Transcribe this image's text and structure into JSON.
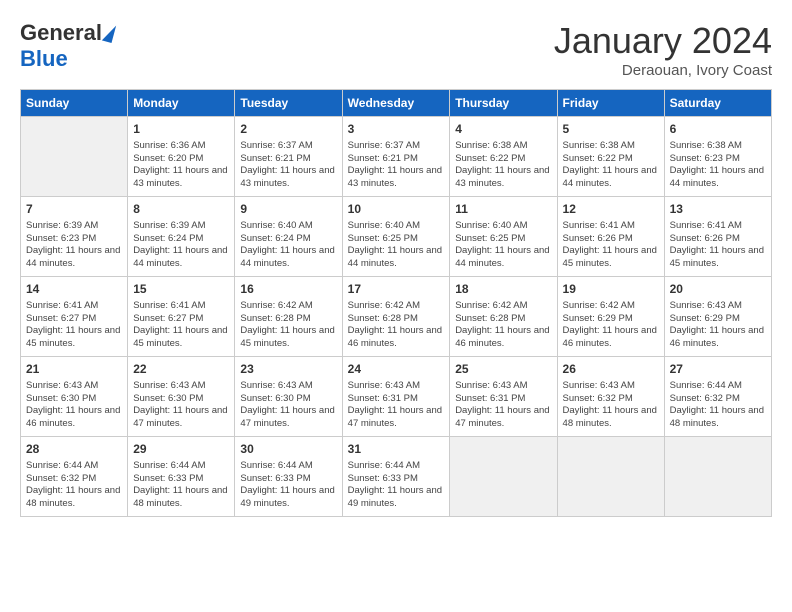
{
  "header": {
    "logo_general": "General",
    "logo_blue": "Blue",
    "month_title": "January 2024",
    "subtitle": "Deraouan, Ivory Coast"
  },
  "days_of_week": [
    "Sunday",
    "Monday",
    "Tuesday",
    "Wednesday",
    "Thursday",
    "Friday",
    "Saturday"
  ],
  "weeks": [
    [
      {
        "day": "",
        "sunrise": "",
        "sunset": "",
        "daylight": ""
      },
      {
        "day": "1",
        "sunrise": "Sunrise: 6:36 AM",
        "sunset": "Sunset: 6:20 PM",
        "daylight": "Daylight: 11 hours and 43 minutes."
      },
      {
        "day": "2",
        "sunrise": "Sunrise: 6:37 AM",
        "sunset": "Sunset: 6:21 PM",
        "daylight": "Daylight: 11 hours and 43 minutes."
      },
      {
        "day": "3",
        "sunrise": "Sunrise: 6:37 AM",
        "sunset": "Sunset: 6:21 PM",
        "daylight": "Daylight: 11 hours and 43 minutes."
      },
      {
        "day": "4",
        "sunrise": "Sunrise: 6:38 AM",
        "sunset": "Sunset: 6:22 PM",
        "daylight": "Daylight: 11 hours and 43 minutes."
      },
      {
        "day": "5",
        "sunrise": "Sunrise: 6:38 AM",
        "sunset": "Sunset: 6:22 PM",
        "daylight": "Daylight: 11 hours and 44 minutes."
      },
      {
        "day": "6",
        "sunrise": "Sunrise: 6:38 AM",
        "sunset": "Sunset: 6:23 PM",
        "daylight": "Daylight: 11 hours and 44 minutes."
      }
    ],
    [
      {
        "day": "7",
        "sunrise": "Sunrise: 6:39 AM",
        "sunset": "Sunset: 6:23 PM",
        "daylight": "Daylight: 11 hours and 44 minutes."
      },
      {
        "day": "8",
        "sunrise": "Sunrise: 6:39 AM",
        "sunset": "Sunset: 6:24 PM",
        "daylight": "Daylight: 11 hours and 44 minutes."
      },
      {
        "day": "9",
        "sunrise": "Sunrise: 6:40 AM",
        "sunset": "Sunset: 6:24 PM",
        "daylight": "Daylight: 11 hours and 44 minutes."
      },
      {
        "day": "10",
        "sunrise": "Sunrise: 6:40 AM",
        "sunset": "Sunset: 6:25 PM",
        "daylight": "Daylight: 11 hours and 44 minutes."
      },
      {
        "day": "11",
        "sunrise": "Sunrise: 6:40 AM",
        "sunset": "Sunset: 6:25 PM",
        "daylight": "Daylight: 11 hours and 44 minutes."
      },
      {
        "day": "12",
        "sunrise": "Sunrise: 6:41 AM",
        "sunset": "Sunset: 6:26 PM",
        "daylight": "Daylight: 11 hours and 45 minutes."
      },
      {
        "day": "13",
        "sunrise": "Sunrise: 6:41 AM",
        "sunset": "Sunset: 6:26 PM",
        "daylight": "Daylight: 11 hours and 45 minutes."
      }
    ],
    [
      {
        "day": "14",
        "sunrise": "Sunrise: 6:41 AM",
        "sunset": "Sunset: 6:27 PM",
        "daylight": "Daylight: 11 hours and 45 minutes."
      },
      {
        "day": "15",
        "sunrise": "Sunrise: 6:41 AM",
        "sunset": "Sunset: 6:27 PM",
        "daylight": "Daylight: 11 hours and 45 minutes."
      },
      {
        "day": "16",
        "sunrise": "Sunrise: 6:42 AM",
        "sunset": "Sunset: 6:28 PM",
        "daylight": "Daylight: 11 hours and 45 minutes."
      },
      {
        "day": "17",
        "sunrise": "Sunrise: 6:42 AM",
        "sunset": "Sunset: 6:28 PM",
        "daylight": "Daylight: 11 hours and 46 minutes."
      },
      {
        "day": "18",
        "sunrise": "Sunrise: 6:42 AM",
        "sunset": "Sunset: 6:28 PM",
        "daylight": "Daylight: 11 hours and 46 minutes."
      },
      {
        "day": "19",
        "sunrise": "Sunrise: 6:42 AM",
        "sunset": "Sunset: 6:29 PM",
        "daylight": "Daylight: 11 hours and 46 minutes."
      },
      {
        "day": "20",
        "sunrise": "Sunrise: 6:43 AM",
        "sunset": "Sunset: 6:29 PM",
        "daylight": "Daylight: 11 hours and 46 minutes."
      }
    ],
    [
      {
        "day": "21",
        "sunrise": "Sunrise: 6:43 AM",
        "sunset": "Sunset: 6:30 PM",
        "daylight": "Daylight: 11 hours and 46 minutes."
      },
      {
        "day": "22",
        "sunrise": "Sunrise: 6:43 AM",
        "sunset": "Sunset: 6:30 PM",
        "daylight": "Daylight: 11 hours and 47 minutes."
      },
      {
        "day": "23",
        "sunrise": "Sunrise: 6:43 AM",
        "sunset": "Sunset: 6:30 PM",
        "daylight": "Daylight: 11 hours and 47 minutes."
      },
      {
        "day": "24",
        "sunrise": "Sunrise: 6:43 AM",
        "sunset": "Sunset: 6:31 PM",
        "daylight": "Daylight: 11 hours and 47 minutes."
      },
      {
        "day": "25",
        "sunrise": "Sunrise: 6:43 AM",
        "sunset": "Sunset: 6:31 PM",
        "daylight": "Daylight: 11 hours and 47 minutes."
      },
      {
        "day": "26",
        "sunrise": "Sunrise: 6:43 AM",
        "sunset": "Sunset: 6:32 PM",
        "daylight": "Daylight: 11 hours and 48 minutes."
      },
      {
        "day": "27",
        "sunrise": "Sunrise: 6:44 AM",
        "sunset": "Sunset: 6:32 PM",
        "daylight": "Daylight: 11 hours and 48 minutes."
      }
    ],
    [
      {
        "day": "28",
        "sunrise": "Sunrise: 6:44 AM",
        "sunset": "Sunset: 6:32 PM",
        "daylight": "Daylight: 11 hours and 48 minutes."
      },
      {
        "day": "29",
        "sunrise": "Sunrise: 6:44 AM",
        "sunset": "Sunset: 6:33 PM",
        "daylight": "Daylight: 11 hours and 48 minutes."
      },
      {
        "day": "30",
        "sunrise": "Sunrise: 6:44 AM",
        "sunset": "Sunset: 6:33 PM",
        "daylight": "Daylight: 11 hours and 49 minutes."
      },
      {
        "day": "31",
        "sunrise": "Sunrise: 6:44 AM",
        "sunset": "Sunset: 6:33 PM",
        "daylight": "Daylight: 11 hours and 49 minutes."
      },
      {
        "day": "",
        "sunrise": "",
        "sunset": "",
        "daylight": ""
      },
      {
        "day": "",
        "sunrise": "",
        "sunset": "",
        "daylight": ""
      },
      {
        "day": "",
        "sunrise": "",
        "sunset": "",
        "daylight": ""
      }
    ]
  ]
}
